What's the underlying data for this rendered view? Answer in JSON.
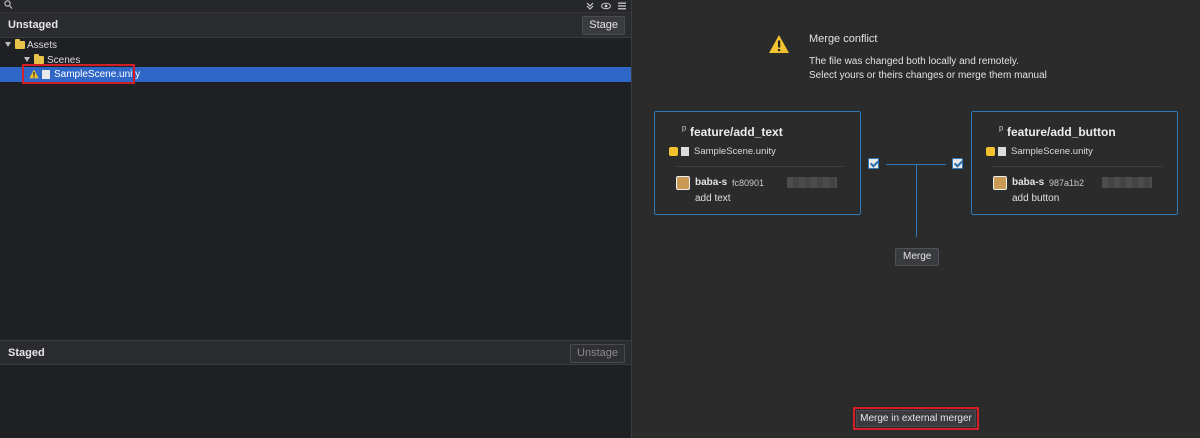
{
  "left_panel": {
    "unstaged": {
      "title": "Unstaged",
      "stage_button": "Stage",
      "tree": [
        {
          "label": "Assets",
          "type": "folder",
          "depth": 0
        },
        {
          "label": "Scenes",
          "type": "folder",
          "depth": 1
        },
        {
          "label": "SampleScene.unity",
          "type": "file",
          "status": "conflict",
          "selected": true,
          "depth": 2
        }
      ]
    },
    "staged": {
      "title": "Staged",
      "unstage_button": "Unstage"
    }
  },
  "right_panel": {
    "title": "Merge conflict",
    "description_line1": "The file was changed both locally and remotely.",
    "description_line2": "Select yours or theirs changes or merge them manual",
    "local": {
      "branch": "feature/add_text",
      "file": "SampleScene.unity",
      "author": "baba-s",
      "hash": "fc80901",
      "message": "add text",
      "checked": true
    },
    "remote": {
      "branch": "feature/add_button",
      "file": "SampleScene.unity",
      "author": "baba-s",
      "hash": "987a1b2",
      "message": "add button",
      "checked": true
    },
    "merge_button": "Merge",
    "external_merge_button": "Merge in external merger"
  },
  "colors": {
    "selection": "#2f67c9",
    "accent_border": "#2f79b8",
    "highlight_box": "#d21f27",
    "warning": "#f2c230"
  },
  "icons": [
    "search-icon",
    "chevron-double-down-icon",
    "eye-icon",
    "menu-icon",
    "folder-icon",
    "warning-icon",
    "unity-file-icon",
    "branch-icon",
    "checkbox-checked-icon"
  ]
}
